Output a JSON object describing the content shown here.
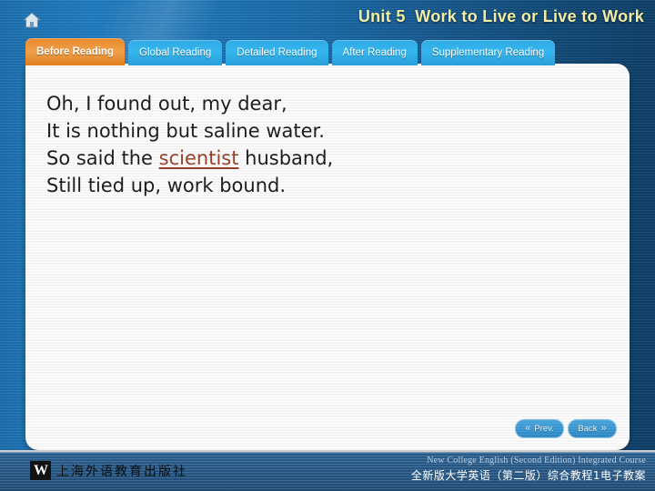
{
  "header": {
    "home_icon": "home-icon",
    "title": "Unit 5  Work to Live or Live to Work",
    "title_color": "#f2eca4"
  },
  "tabs": [
    {
      "label": "Before Reading",
      "active": true
    },
    {
      "label": "Global Reading",
      "active": false
    },
    {
      "label": "Detailed Reading",
      "active": false
    },
    {
      "label": "After Reading",
      "active": false
    },
    {
      "label": "Supplementary Reading",
      "active": false
    }
  ],
  "accent": {
    "active_tab": "#e8892a",
    "inactive_tab": "#35b6ee",
    "keyword": "#9c3f25",
    "background": "#1a6aa8"
  },
  "poem": {
    "line1": "Oh, I found out, my dear,",
    "line2": "It is nothing but saline water.",
    "line3_pre": "So said the ",
    "line3_keyword": "scientist",
    "line3_post": " husband,",
    "line4": "Still tied up, work bound."
  },
  "nav": {
    "prev_chevron": "«",
    "prev_label": "Prev.",
    "back_label": "Back",
    "back_chevron": "»"
  },
  "footer": {
    "publisher_mark": "W",
    "publisher_name": "上海外语教育出版社",
    "course_en": "New College English (Second Edition) Integrated Course",
    "course_zh": "全新版大学英语（第二版）综合教程1电子教案"
  }
}
